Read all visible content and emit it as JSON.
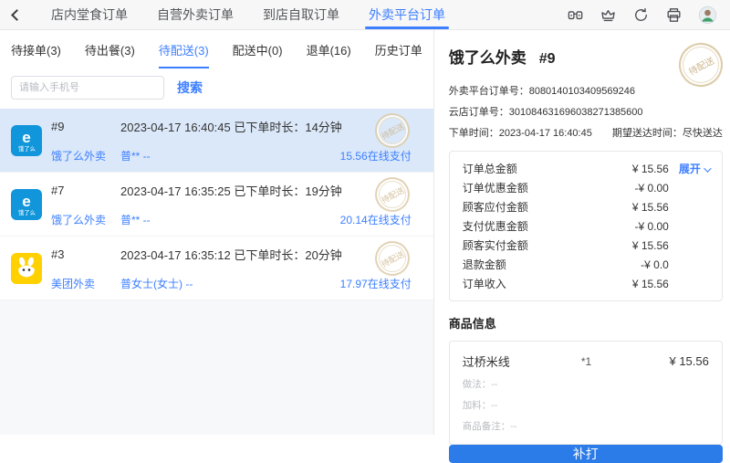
{
  "colors": {
    "accent": "#3d7fff",
    "button_blue": "#2b7be8",
    "selected_row": "#dbe8f9",
    "stamp": "#cdb68c",
    "eleme_blue": "#1296db",
    "meituan_yellow": "#ffd100"
  },
  "topbar": {
    "tabs": [
      {
        "label": "店内堂食订单",
        "active": false
      },
      {
        "label": "自营外卖订单",
        "active": false
      },
      {
        "label": "到店自取订单",
        "active": false
      },
      {
        "label": "外卖平台订单",
        "active": true
      }
    ],
    "icons": [
      "binoculars-icon",
      "crown-icon",
      "refresh-icon",
      "printer-icon",
      "avatar"
    ]
  },
  "left": {
    "subtabs": [
      {
        "label": "待接单(3)",
        "active": false
      },
      {
        "label": "待出餐(3)",
        "active": false
      },
      {
        "label": "待配送(3)",
        "active": true
      },
      {
        "label": "配送中(0)",
        "active": false
      },
      {
        "label": "退单(16)",
        "active": false
      },
      {
        "label": "历史订单",
        "active": false
      }
    ],
    "search": {
      "placeholder": "请输入手机号",
      "button": "搜索"
    },
    "orders": [
      {
        "id": "#9",
        "platform": "饿了么外卖",
        "platform_key": "eleme",
        "logo_e": "e",
        "logo_brand": "饿了么",
        "time": "2023-04-17 16:40:45",
        "duration": "已下单时长：14分钟",
        "customer": "普** --",
        "payment": "15.56在线支付",
        "stamp": "待配送",
        "selected": true
      },
      {
        "id": "#7",
        "platform": "饿了么外卖",
        "platform_key": "eleme",
        "logo_e": "e",
        "logo_brand": "饿了么",
        "time": "2023-04-17 16:35:25",
        "duration": "已下单时长：19分钟",
        "customer": "普** --",
        "payment": "20.14在线支付",
        "stamp": "待配送",
        "selected": false
      },
      {
        "id": "#3",
        "platform": "美团外卖",
        "platform_key": "meituan",
        "time": "2023-04-17 16:35:12",
        "duration": "已下单时长：20分钟",
        "customer": "普女士(女士) --",
        "payment": "17.97在线支付",
        "stamp": "待配送",
        "selected": false
      }
    ]
  },
  "detail": {
    "title": "饿了么外卖",
    "order_id": "#9",
    "stamp": "待配送",
    "platform_no_line": "外卖平台订单号：8080140103409569246",
    "cloud_no_line": "云店订单号：301084631696038271385600",
    "order_time_line": "下单时间：2023-04-17 16:40:45",
    "expect_line": "期望送达时间：尽快送达",
    "amounts": [
      {
        "label": "订单总金额",
        "value": "¥ 15.56",
        "expand": "展开"
      },
      {
        "label": "订单优惠金额",
        "value": "-¥ 0.00"
      },
      {
        "label": "顾客应付金额",
        "value": "¥ 15.56"
      },
      {
        "label": "支付优惠金额",
        "value": "-¥ 0.00"
      },
      {
        "label": "顾客实付金额",
        "value": "¥ 15.56"
      },
      {
        "label": "退款金额",
        "value": "-¥ 0.0"
      },
      {
        "label": "订单收入",
        "value": "¥ 15.56"
      }
    ],
    "goods_title": "商品信息",
    "item": {
      "name": "过桥米线",
      "qty": "*1",
      "price": "¥ 15.56",
      "props": [
        "做法：--",
        "加料：--",
        "商品备注：--"
      ]
    },
    "reprint_label": "补打"
  }
}
